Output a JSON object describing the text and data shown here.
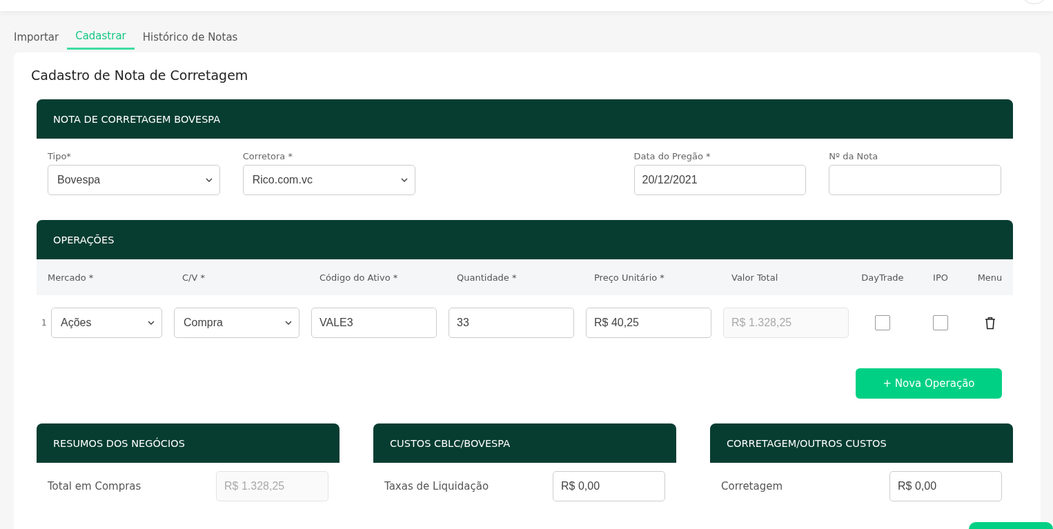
{
  "tabs": [
    {
      "label": "Importar",
      "selected": false
    },
    {
      "label": "Cadastrar",
      "selected": true
    },
    {
      "label": "Histórico de Notas",
      "selected": false
    }
  ],
  "page_title": "Cadastro de Nota de Corretagem",
  "note_section": {
    "title": "NOTA DE CORRETAGEM BOVESPA",
    "fields": [
      {
        "kind": "select",
        "label": "Tipo*",
        "value": "Bovespa"
      },
      {
        "kind": "select",
        "label": "Corretora *",
        "value": "Rico.com.vc"
      },
      {
        "kind": "input",
        "label": "Data do Pregão *",
        "value": "20/12/2021"
      },
      {
        "kind": "input",
        "label": "Nº da Nota"
      }
    ]
  },
  "operations": {
    "title": "OPERAÇÕES",
    "columns": [
      "Mercado *",
      "C/V *",
      "Código do Ativo *",
      "Quantidade *",
      "Preço Unitário *",
      "Valor Total",
      "DayTrade",
      "IPO",
      "Menu"
    ],
    "rows": [
      {
        "index": "1",
        "mercado": "Ações",
        "cv": "Compra",
        "codigo": "VALE3",
        "quantidade": "33",
        "preco": "R$ 40,25",
        "valor_total": "R$ 1.328,25",
        "daytrade": false,
        "ipo": false
      }
    ],
    "add_button": "+ Nova Operação"
  },
  "summaries": [
    {
      "title": "RESUMOS DOS NEGÓCIOS",
      "rows": [
        {
          "label": "Total em Compras",
          "value": "R$ 1.328,25",
          "disabled": true
        }
      ]
    },
    {
      "title": "CUSTOS CBLC/BOVESPA",
      "rows": [
        {
          "label": "Taxas de Liquidação",
          "value": "R$ 0,00",
          "disabled": false
        }
      ]
    },
    {
      "title": "CORRETAGEM/OUTROS CUSTOS",
      "rows": [
        {
          "label": "Corretagem",
          "value": "R$ 0,00",
          "disabled": false
        }
      ]
    }
  ]
}
